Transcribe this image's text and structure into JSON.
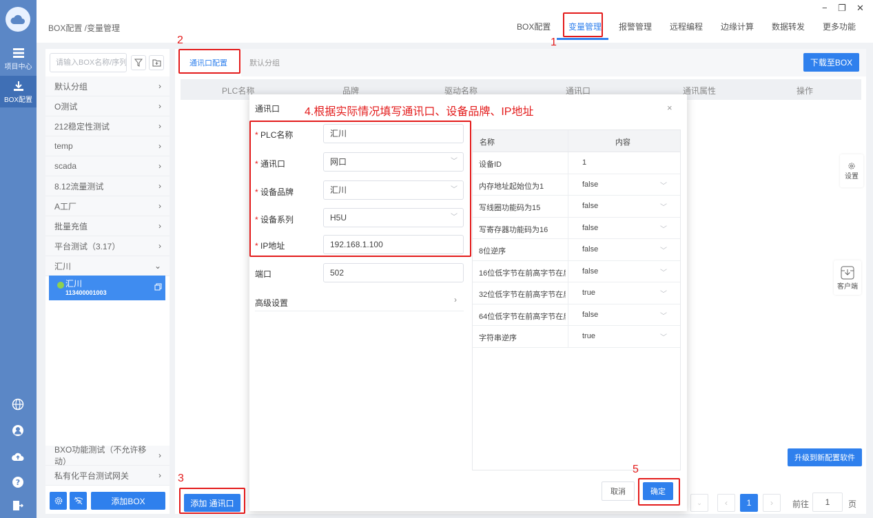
{
  "rail": {
    "items": [
      {
        "label": "项目中心",
        "icon": "grid-icon"
      },
      {
        "label": "BOX配置",
        "icon": "download-icon"
      }
    ]
  },
  "topbar": {
    "breadcrumb": "BOX配置 /变量管理",
    "nav": [
      "BOX配置",
      "变量管理",
      "报警管理",
      "远程编程",
      "边缘计算",
      "数据转发",
      "更多功能"
    ],
    "active_nav": "变量管理",
    "window_controls": [
      "−",
      "❐",
      "✕"
    ]
  },
  "left": {
    "search_placeholder": "请输入BOX名称/序列号",
    "groups": [
      "默认分组",
      "O测试",
      "212稳定性测试",
      "temp",
      "scada",
      "8.12流量测试",
      "A工厂",
      "批量充值",
      "平台测试（3.17）",
      "汇川"
    ],
    "selected_box": {
      "name": "汇川",
      "serial": "113400001003"
    },
    "bottom_groups": [
      "BXO功能测试（不允许移动）",
      "私有化平台测试网关"
    ],
    "add_box": "添加BOX"
  },
  "main": {
    "tabs": [
      "通讯口配置",
      "默认分组"
    ],
    "download_btn": "下载至BOX",
    "columns": [
      "PLC名称",
      "品牌",
      "驱动名称",
      "通讯口",
      "通讯属性",
      "操作"
    ],
    "upgrade_btn": "升级到新配置软件",
    "add_port_btn": "添加 通讯口",
    "pagination": {
      "current": "1",
      "goto_label": "前往",
      "goto_value": "1",
      "page_suffix": "页"
    }
  },
  "floating": [
    {
      "label": "设置",
      "icon": "gear-icon"
    },
    {
      "label": "客户端",
      "icon": "download-box-icon"
    }
  ],
  "annotations": {
    "n1": "1",
    "n2": "2",
    "n3": "3",
    "n5": "5",
    "instruction": "4.根据实际情况填写通讯口、设备品牌、IP地址"
  },
  "dialog": {
    "title": "通讯口",
    "close": "×",
    "fields": [
      {
        "label": "PLC名称",
        "required": "*",
        "value": "汇川",
        "dropdown": false
      },
      {
        "label": "通讯口",
        "required": "*",
        "value": "网口",
        "dropdown": true
      },
      {
        "label": "设备品牌",
        "required": "*",
        "value": "汇川",
        "dropdown": true
      },
      {
        "label": "设备系列",
        "required": "*",
        "value": "H5U",
        "dropdown": true
      },
      {
        "label": "IP地址",
        "required": "*",
        "value": "192.168.1.100",
        "dropdown": false
      }
    ],
    "port": {
      "label": "端口",
      "value": "502"
    },
    "advanced": "高级设置",
    "props_header": {
      "name": "名称",
      "content": "内容"
    },
    "props": [
      {
        "name": "设备ID",
        "value": "1",
        "dropdown": false
      },
      {
        "name": "内存地址起始位为1",
        "value": "false",
        "dropdown": true
      },
      {
        "name": "写线圈功能码为15",
        "value": "false",
        "dropdown": true
      },
      {
        "name": "写寄存器功能码为16",
        "value": "false",
        "dropdown": true
      },
      {
        "name": "8位逆序",
        "value": "false",
        "dropdown": true
      },
      {
        "name": "16位低字节在前高字节在后",
        "value": "false",
        "dropdown": true
      },
      {
        "name": "32位低字节在前高字节在后",
        "value": "true",
        "dropdown": true
      },
      {
        "name": "64位低字节在前高字节在后",
        "value": "false",
        "dropdown": true
      },
      {
        "name": "字符串逆序",
        "value": "true",
        "dropdown": true
      }
    ],
    "cancel": "取消",
    "ok": "确定"
  },
  "colors": {
    "accent": "#2f80ed",
    "rail": "#5b87c6",
    "annotation": "#e31a1a"
  }
}
